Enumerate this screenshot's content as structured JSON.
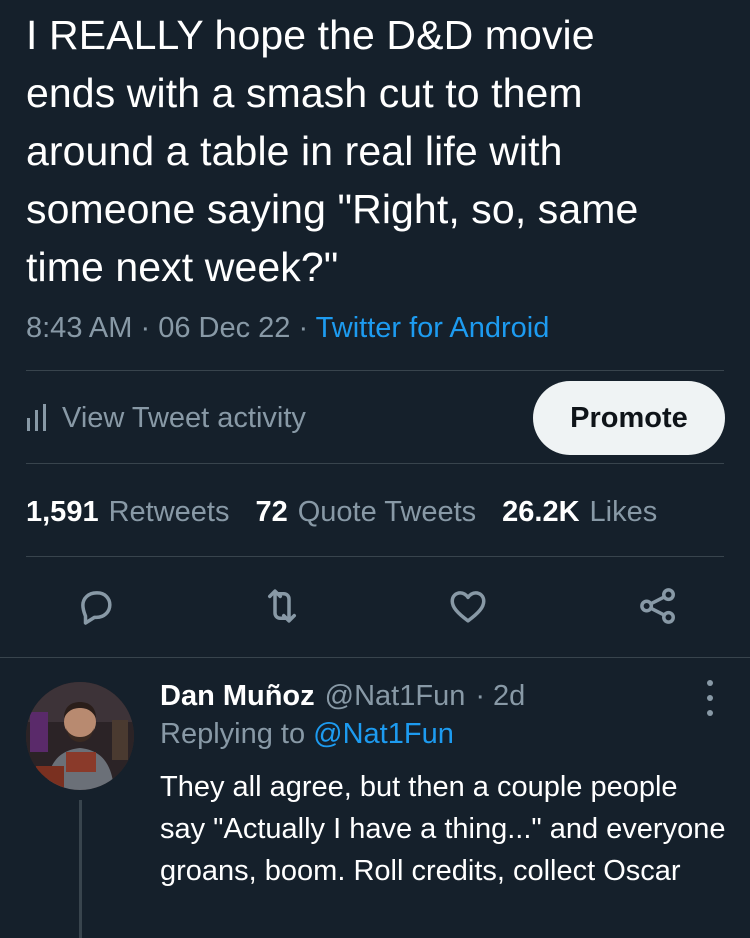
{
  "tweet": {
    "text": "I REALLY hope the D&D movie\nends with a smash cut to them\naround a table in real life with\nsomeone saying \"Right, so, same\ntime next week?\"",
    "time": "8:43 AM",
    "date": "06 Dec 22",
    "separator": " · ",
    "source": "Twitter for Android"
  },
  "activity": {
    "label": "View Tweet activity",
    "icon": "bar-chart-icon"
  },
  "promote_label": "Promote",
  "stats": {
    "retweets_count": "1,591",
    "retweets_label": "Retweets",
    "quotes_count": "72",
    "quotes_label": "Quote Tweets",
    "likes_count": "26.2K",
    "likes_label": "Likes"
  },
  "actions": [
    "reply-icon",
    "retweet-icon",
    "like-icon",
    "share-icon"
  ],
  "reply": {
    "name": "Dan Muñoz",
    "handle": "@Nat1Fun",
    "age": "· 2d",
    "replying_prefix": "Replying to",
    "replying_handle": "@Nat1Fun",
    "text": "They all agree, but then a couple people say \"Actually I have a thing...\" and everyone groans, boom. Roll credits, collect Oscar"
  },
  "colors": {
    "background": "#15202b",
    "secondary_text": "#8899a6",
    "link": "#1d9bf0",
    "divider": "#38444d"
  }
}
